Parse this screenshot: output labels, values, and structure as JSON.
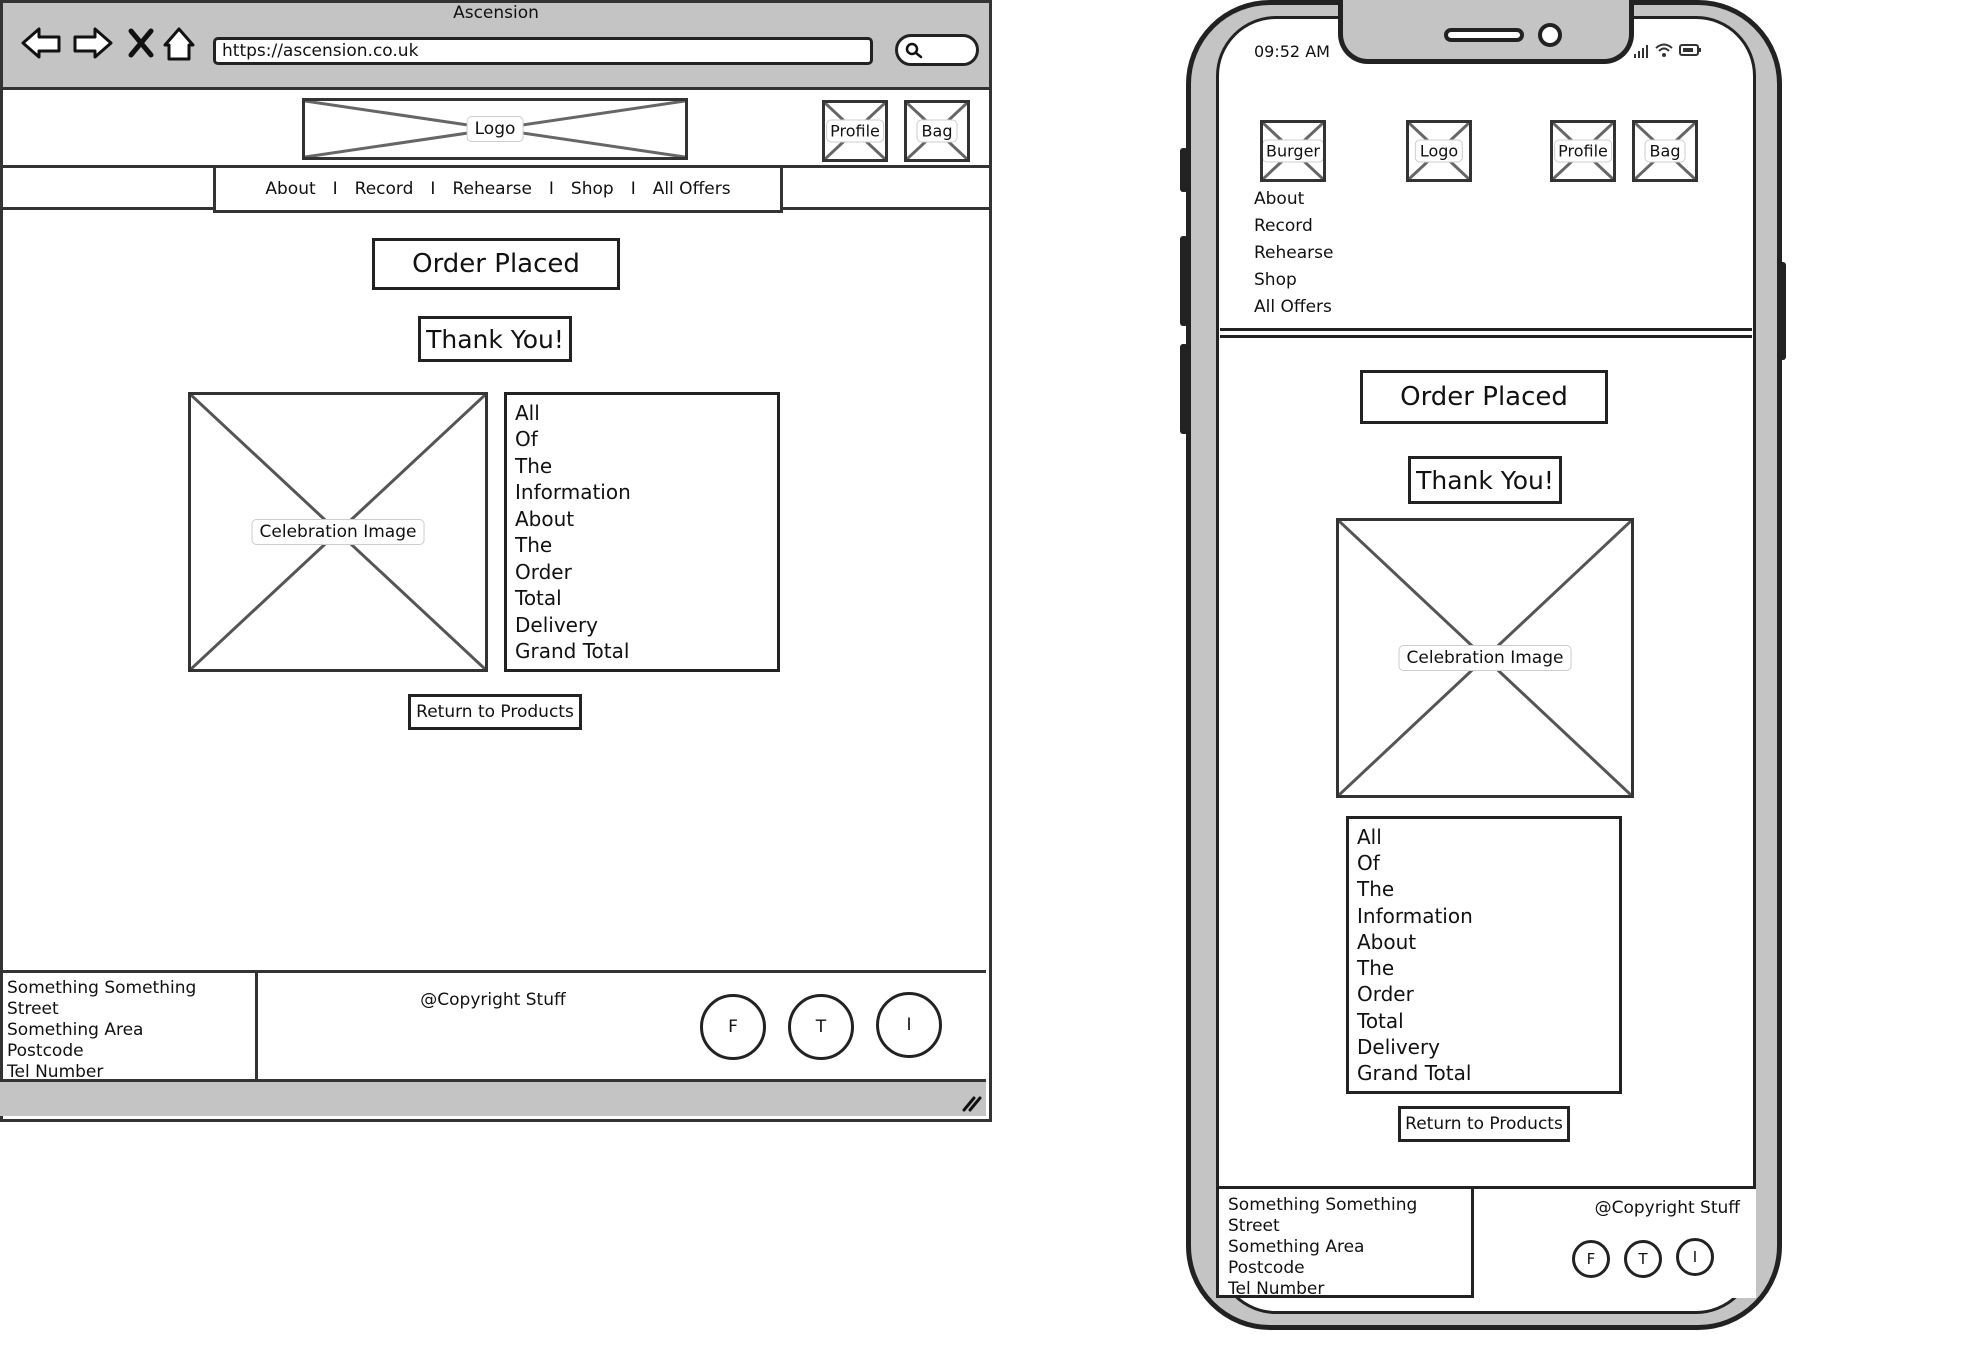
{
  "desktop": {
    "browser_title": "Ascension",
    "url": "https://ascension.co.uk",
    "logo": "Logo",
    "profile": "Profile",
    "bag": "Bag",
    "nav": [
      "About",
      "Record",
      "Rehearse",
      "Shop",
      "All Offers"
    ],
    "nav_separator": "I",
    "order_placed": "Order Placed",
    "thank_you": "Thank You!",
    "celebration_image": "Celebration Image",
    "info_lines": [
      "All",
      "Of",
      "The",
      "Information",
      "About",
      "The",
      "Order",
      "Total",
      "Delivery",
      "Grand Total"
    ],
    "return_button": "Return to Products",
    "footer": {
      "address": [
        "Something Something Street",
        "Something Area",
        "Postcode",
        "Tel Number"
      ],
      "copyright": "@Copyright Stuff",
      "social": [
        "F",
        "T",
        "I"
      ]
    }
  },
  "mobile": {
    "time": "09:52 AM",
    "burger": "Burger",
    "logo": "Logo",
    "profile": "Profile",
    "bag": "Bag",
    "menu": [
      "About",
      "Record",
      "Rehearse",
      "Shop",
      "All Offers"
    ],
    "order_placed": "Order Placed",
    "thank_you": "Thank You!",
    "celebration_image": "Celebration Image",
    "info_lines": [
      "All",
      "Of",
      "The",
      "Information",
      "About",
      "The",
      "Order",
      "Total",
      "Delivery",
      "Grand Total"
    ],
    "return_button": "Return to Products",
    "footer": {
      "address": [
        "Something Something Street",
        "Something Area",
        "Postcode",
        "Tel Number"
      ],
      "copyright": "@Copyright Stuff",
      "social": [
        "F",
        "T",
        "I"
      ]
    }
  }
}
